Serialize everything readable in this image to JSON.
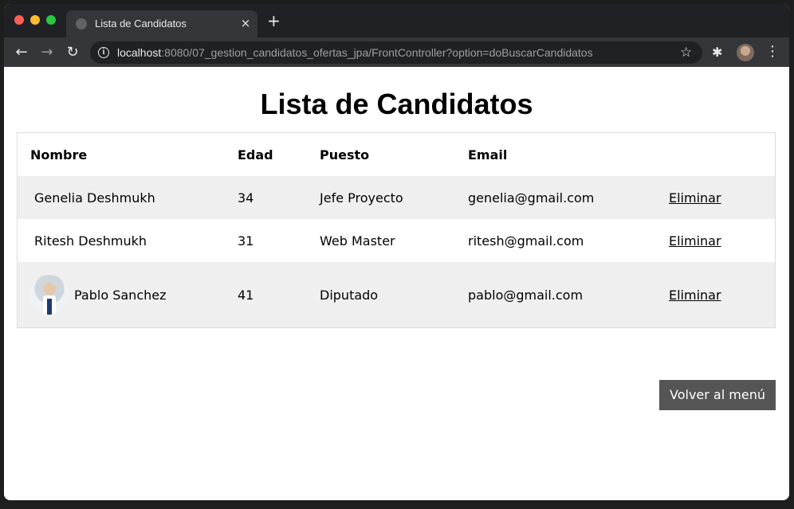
{
  "browser": {
    "tab_title": "Lista de Candidatos",
    "tab_close": "×",
    "new_tab": "+",
    "url_host": "localhost",
    "url_rest": ":8080/07_gestion_candidatos_ofertas_jpa/FrontController?option=doBuscarCandidatos",
    "icons": {
      "back": "←",
      "forward": "→",
      "reload": "↻",
      "info": "i",
      "star": "☆",
      "extensions": "✱",
      "menu": "⋮"
    }
  },
  "page": {
    "title": "Lista de Candidatos",
    "table": {
      "headers": [
        "Nombre",
        "Edad",
        "Puesto",
        "Email",
        ""
      ],
      "rows": [
        {
          "nombre": "Genelia Deshmukh",
          "edad": "34",
          "puesto": "Jefe Proyecto",
          "email": "genelia@gmail.com",
          "accion": "Eliminar",
          "has_photo": false
        },
        {
          "nombre": "Ritesh Deshmukh",
          "edad": "31",
          "puesto": "Web Master",
          "email": "ritesh@gmail.com",
          "accion": "Eliminar",
          "has_photo": false
        },
        {
          "nombre": "Pablo Sanchez",
          "edad": "41",
          "puesto": "Diputado",
          "email": "pablo@gmail.com",
          "accion": "Eliminar",
          "has_photo": true
        }
      ]
    },
    "back_button": "Volver al menú"
  }
}
